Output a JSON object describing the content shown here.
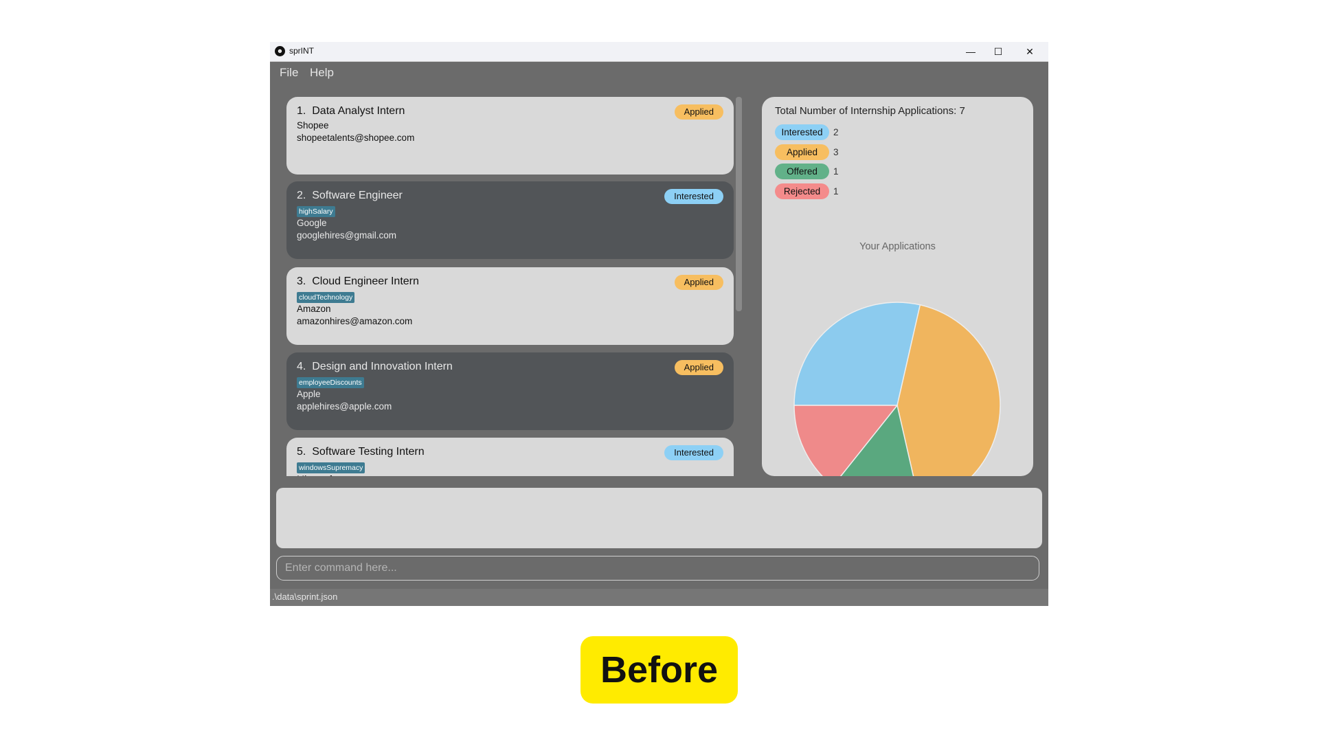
{
  "window": {
    "title": "sprINT",
    "controls": {
      "minimize": "—",
      "maximize": "☐",
      "close": "✕"
    }
  },
  "menu": {
    "items": [
      {
        "label": "File"
      },
      {
        "label": "Help"
      }
    ]
  },
  "applications": [
    {
      "index": "1.",
      "role": "Data Analyst Intern",
      "tag": "",
      "company": "Shopee",
      "email": "shopeetalents@shopee.com",
      "status": "Applied",
      "theme": "light"
    },
    {
      "index": "2.",
      "role": "Software Engineer",
      "tag": "highSalary",
      "company": "Google",
      "email": "googlehires@gmail.com",
      "status": "Interested",
      "theme": "dark"
    },
    {
      "index": "3.",
      "role": "Cloud Engineer Intern",
      "tag": "cloudTechnology",
      "company": "Amazon",
      "email": "amazonhires@amazon.com",
      "status": "Applied",
      "theme": "light"
    },
    {
      "index": "4.",
      "role": "Design and Innovation Intern",
      "tag": "employeeDiscounts",
      "company": "Apple",
      "email": "applehires@apple.com",
      "status": "Applied",
      "theme": "dark"
    },
    {
      "index": "5.",
      "role": "Software Testing Intern",
      "tag": "windowsSupremacy",
      "company": "Microsoft",
      "email": "",
      "status": "Interested",
      "theme": "light"
    }
  ],
  "status_colors": {
    "Interested": "#8dd0f5",
    "Applied": "#f7be60",
    "Offered": "#62b189",
    "Rejected": "#f48b8b"
  },
  "stats": {
    "total_label": "Total Number of Internship Applications: 7",
    "rows": [
      {
        "label": "Interested",
        "count": "2"
      },
      {
        "label": "Applied",
        "count": "3"
      },
      {
        "label": "Offered",
        "count": "1"
      },
      {
        "label": "Rejected",
        "count": "1"
      }
    ]
  },
  "chart_data": {
    "type": "pie",
    "title": "Your Applications",
    "categories": [
      "Interested",
      "Applied",
      "Offered",
      "Rejected"
    ],
    "values": [
      2,
      3,
      1,
      1
    ],
    "colors": [
      "#8ccbee",
      "#f0b55e",
      "#5aa87f",
      "#ef8a8a"
    ],
    "start": "left, clockwise"
  },
  "result_display": {
    "text": ""
  },
  "command": {
    "placeholder": "Enter command here...",
    "value": ""
  },
  "statusbar": {
    "path": ".\\data\\sprint.json"
  },
  "caption": "Before"
}
